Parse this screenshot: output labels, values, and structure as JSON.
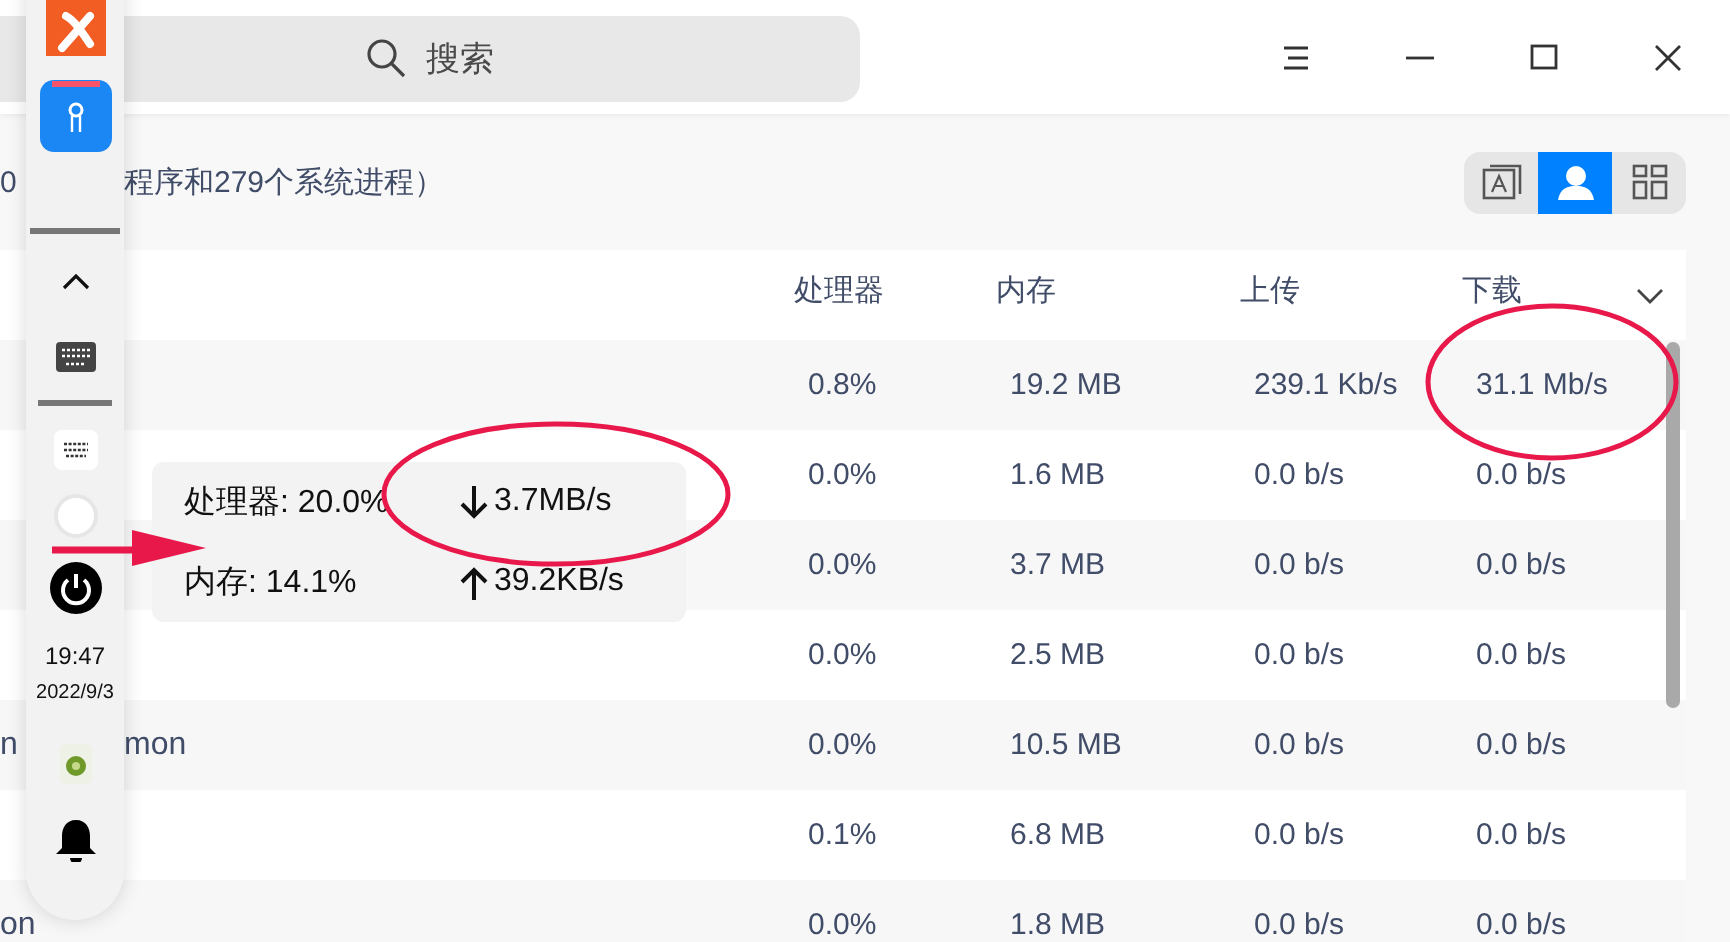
{
  "search": {
    "placeholder": "搜索"
  },
  "window_controls": [
    {
      "kind": "menu"
    },
    {
      "kind": "minimize"
    },
    {
      "kind": "maximize"
    },
    {
      "kind": "close"
    }
  ],
  "summary": {
    "parts": [
      "0",
      "程序和279个系统进程）"
    ]
  },
  "view_modes": [
    {
      "kind": "apps",
      "selected": false
    },
    {
      "kind": "user",
      "selected": true
    },
    {
      "kind": "detail",
      "selected": false
    }
  ],
  "table": {
    "columns": [
      "处理器",
      "内存",
      "上传",
      "下载"
    ],
    "rows": [
      {
        "name": [],
        "cpu": "0.8%",
        "memory": "19.2 MB",
        "upload": "239.1 Kb/s",
        "download": "31.1 Mb/s"
      },
      {
        "name": [],
        "cpu": "0.0%",
        "memory": "1.6 MB",
        "upload": "0.0 b/s",
        "download": "0.0 b/s"
      },
      {
        "name": [],
        "cpu": "0.0%",
        "memory": "3.7 MB",
        "upload": "0.0 b/s",
        "download": "0.0 b/s"
      },
      {
        "name": [],
        "cpu": "0.0%",
        "memory": "2.5 MB",
        "upload": "0.0 b/s",
        "download": "0.0 b/s"
      },
      {
        "name": [
          "n",
          "mon"
        ],
        "cpu": "0.0%",
        "memory": "10.5 MB",
        "upload": "0.0 b/s",
        "download": "0.0 b/s"
      },
      {
        "name": [],
        "cpu": "0.1%",
        "memory": "6.8 MB",
        "upload": "0.0 b/s",
        "download": "0.0 b/s"
      },
      {
        "name": [
          "on"
        ],
        "cpu": "0.0%",
        "memory": "1.8 MB",
        "upload": "0.0 b/s",
        "download": "0.0 b/s"
      }
    ]
  },
  "dock": {
    "items": [
      {
        "kind": "tools-app"
      },
      {
        "kind": "mail-app"
      },
      {
        "kind": "separator"
      },
      {
        "kind": "expand"
      },
      {
        "kind": "keyboard"
      },
      {
        "kind": "separator"
      },
      {
        "kind": "keyboard-small"
      },
      {
        "kind": "circle"
      },
      {
        "kind": "power"
      },
      {
        "kind": "clock",
        "time": "19:47",
        "date": "2022/9/3"
      },
      {
        "kind": "plugin"
      },
      {
        "kind": "bell"
      }
    ]
  },
  "tooltip": {
    "cpu": "处理器: 20.0%",
    "download": "3.7MB/s",
    "memory": "内存: 14.1%",
    "upload": "39.2KB/s"
  },
  "annotations": [
    {
      "kind": "ellipse"
    },
    {
      "kind": "ellipse"
    },
    {
      "kind": "arrow"
    }
  ]
}
